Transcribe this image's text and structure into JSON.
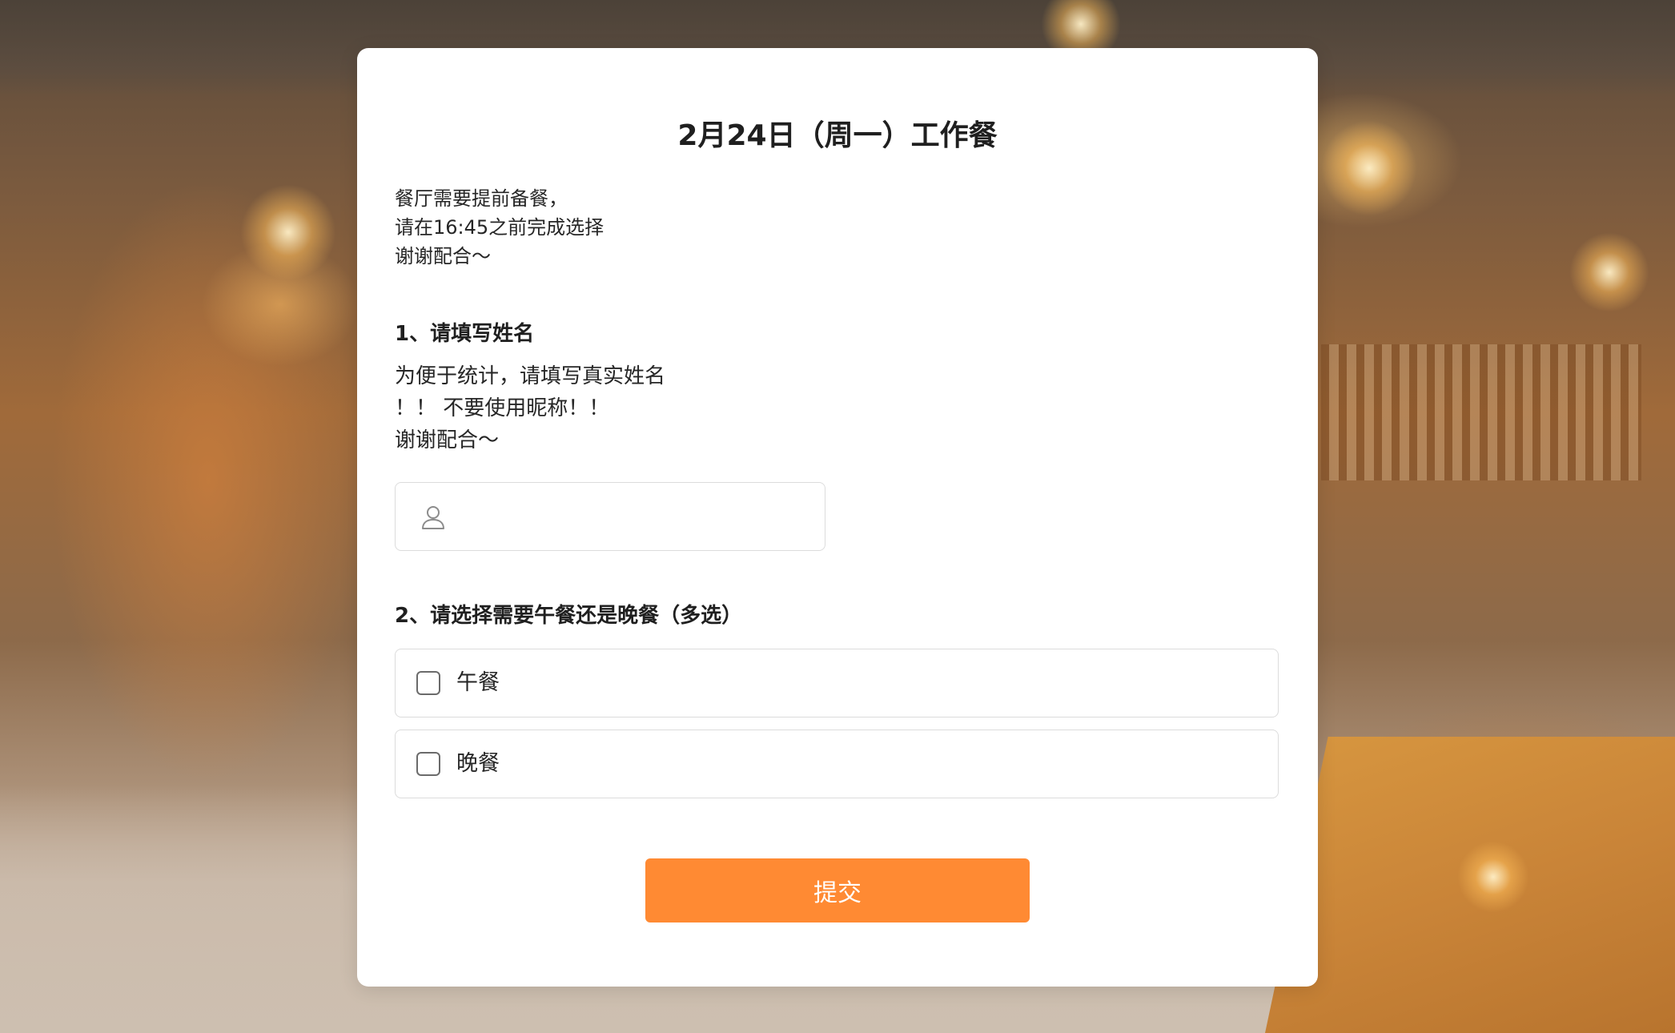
{
  "colors": {
    "accent": "#ff8a33",
    "card_background": "#ffffff",
    "text_primary": "#1f1f1f",
    "border": "#dcdcdc"
  },
  "form": {
    "title": "2月24日（周一）工作餐",
    "intro_lines": [
      "餐厅需要提前备餐，",
      "请在16:45之前完成选择",
      "谢谢配合～"
    ],
    "questions": [
      {
        "title": "1、请填写姓名",
        "description_lines": [
          "为便于统计，请填写真实姓名",
          "！！ 不要使用昵称！！",
          "谢谢配合～"
        ],
        "input": {
          "value": "",
          "placeholder": "",
          "icon": "user-icon"
        }
      },
      {
        "title": "2、请选择需要午餐还是晚餐（多选）",
        "options": [
          {
            "label": "午餐",
            "checked": false
          },
          {
            "label": "晚餐",
            "checked": false
          }
        ]
      }
    ],
    "submit_label": "提交"
  }
}
